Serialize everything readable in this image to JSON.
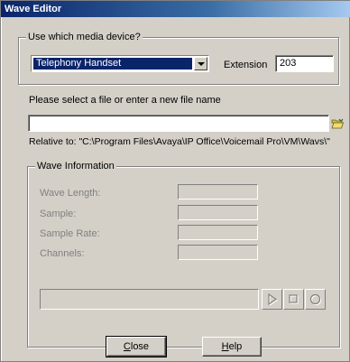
{
  "window": {
    "title": "Wave Editor"
  },
  "media_group": {
    "legend": "Use which media device?",
    "device_value": "Telephony Handset",
    "extension_label": "Extension",
    "extension_value": "203"
  },
  "file": {
    "prompt": "Please select a file or enter a new file name",
    "value": "",
    "relative_to": "Relative to: \"C:\\Program Files\\Avaya\\IP Office\\Voicemail Pro\\VM\\Wavs\\\""
  },
  "wave_info": {
    "legend": "Wave Information",
    "fields": [
      {
        "label": "Wave Length:",
        "value": ""
      },
      {
        "label": "Sample:",
        "value": ""
      },
      {
        "label": "Sample Rate:",
        "value": ""
      },
      {
        "label": "Channels:",
        "value": ""
      }
    ]
  },
  "player": {
    "icons": [
      "play-icon",
      "stop-icon",
      "record-icon"
    ]
  },
  "buttons": {
    "close_prefix": "",
    "close_accel": "C",
    "close_rest": "lose",
    "help_prefix": "",
    "help_accel": "H",
    "help_rest": "elp"
  },
  "colors": {
    "face": "#d4d0c8",
    "selection": "#0a246a",
    "title_start": "#0a246a"
  }
}
